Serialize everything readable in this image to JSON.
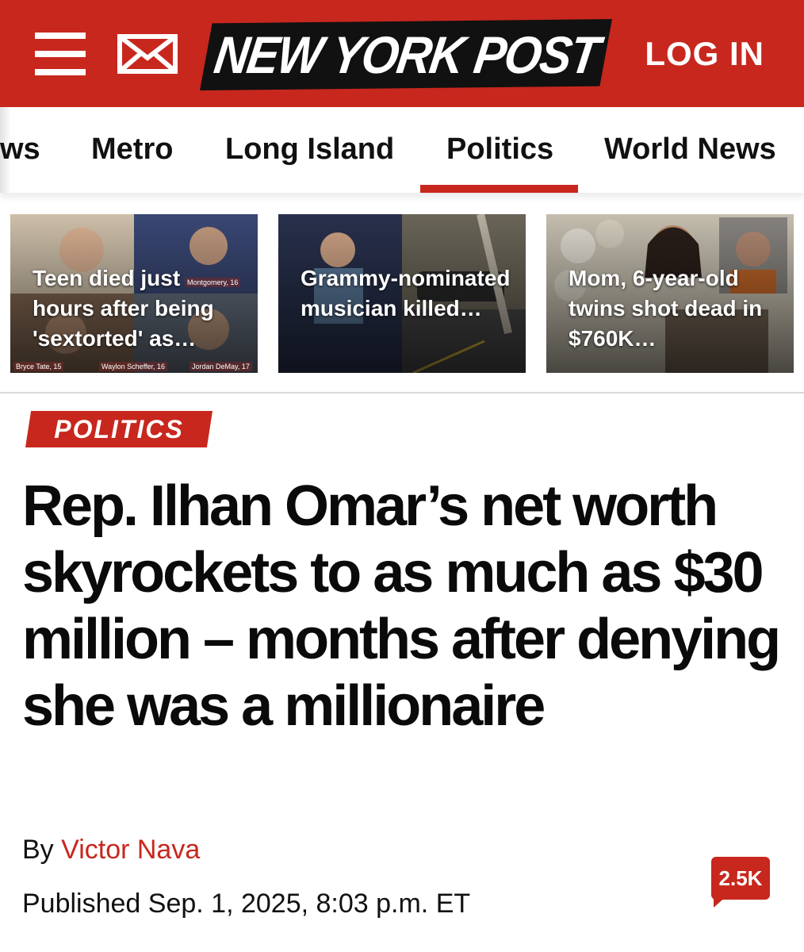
{
  "header": {
    "logo_text": "NEW YORK POST",
    "login_label": "LOG IN",
    "menu_icon": "hamburger-menu-icon",
    "mail_icon": "mail-icon",
    "brand_color": "#c8271e"
  },
  "nav": {
    "tabs": [
      {
        "label": "ws"
      },
      {
        "label": "Metro"
      },
      {
        "label": "Long Island"
      },
      {
        "label": "Politics",
        "active": true
      },
      {
        "label": "World News"
      }
    ]
  },
  "stories": [
    {
      "caption": "Teen died just hours after being 'sextorted' as…",
      "photo_labels": [
        "Montgomery, 16",
        "Bryce Tate, 15",
        "Waylon Scheffer, 16",
        "Jordan DeMay, 17"
      ]
    },
    {
      "caption": "Grammy-nominated musician killed…"
    },
    {
      "caption": "Mom, 6-year-old twins shot dead in $760K…"
    }
  ],
  "article": {
    "section": "POLITICS",
    "headline": "Rep. Ilhan Omar’s net worth skyrockets to as much as $30 million – months after denying she was a millionaire",
    "byline_prefix": "By ",
    "author": "Victor Nava",
    "published": "Published Sep. 1, 2025, 8:03 p.m. ET",
    "comment_count": "2.5K"
  }
}
